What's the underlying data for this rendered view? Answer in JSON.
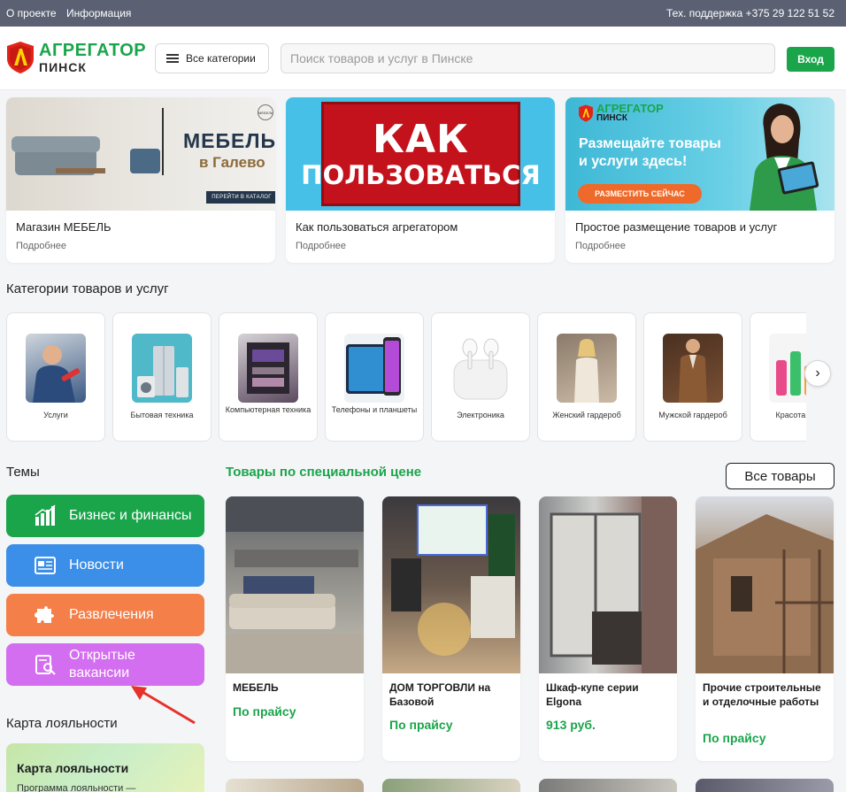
{
  "topbar": {
    "links": [
      "О проекте",
      "Информация"
    ],
    "support": "Тех. поддержка +375 29 122 51 52"
  },
  "header": {
    "logo_line1": "АГРЕГАТОР",
    "logo_line2": "ПИНСК",
    "categories_button": "Все категории",
    "search_placeholder": "Поиск товаров и услуг в Пинске",
    "login_button": "Вход"
  },
  "promos": [
    {
      "title": "Магазин МЕБЕЛЬ",
      "more": "Подробнее",
      "banner_headline": "МЕБЕЛЬ",
      "banner_sub": "в Галево",
      "banner_cta": "ПЕРЕЙТИ В КАТАЛОГ",
      "banner_logo": "МЕБЕЛЬ"
    },
    {
      "title": "Как пользоваться агрегатором",
      "more": "Подробнее",
      "banner_line1": "КАК",
      "banner_line2": "ПОЛЬЗОВАТЬСЯ"
    },
    {
      "title": "Простое размещение товаров и услуг",
      "more": "Подробнее",
      "banner_logo1": "АГРЕГАТОР",
      "banner_logo2": "ПИНСК",
      "banner_head1": "Размещайте товары",
      "banner_head2": "и услуги здесь!",
      "banner_cta": "РАЗМЕСТИТЬ СЕЙЧАС"
    }
  ],
  "categories_section": {
    "title": "Категории товаров и услуг",
    "items": [
      {
        "label": "Услуги"
      },
      {
        "label": "Бытовая техника"
      },
      {
        "label": "Компьютерная техника"
      },
      {
        "label": "Телефоны и планшеты"
      },
      {
        "label": "Электроника"
      },
      {
        "label": "Женский гардероб"
      },
      {
        "label": "Мужской гардероб"
      },
      {
        "label": "Красота и зд"
      }
    ],
    "next_arrow": "›"
  },
  "themes": {
    "title": "Темы",
    "items": [
      {
        "label": "Бизнес и финансы",
        "color": "#1aa54b",
        "icon": "chart-icon"
      },
      {
        "label": "Новости",
        "color": "#3b8fe8",
        "icon": "newspaper-icon"
      },
      {
        "label": "Развлечения",
        "color": "#f47f49",
        "icon": "puzzle-icon"
      },
      {
        "label": "Открытые вакансии",
        "color": "#d46ef0",
        "icon": "job-search-icon"
      }
    ]
  },
  "loyalty": {
    "section_title": "Карта лояльности",
    "card_title": "Карта лояльности",
    "card_sub": "Программа лояльности —"
  },
  "special": {
    "title": "Товары по специальной цене",
    "all_button": "Все товары",
    "products": [
      {
        "name": "МЕБЕЛЬ",
        "price": "По прайсу"
      },
      {
        "name": "ДОМ ТОРГОВЛИ на Базовой",
        "price": "По прайсу"
      },
      {
        "name": "Шкаф-купе серии Elgona",
        "price": "913 руб."
      },
      {
        "name": "Прочие строительные и отделочные работы",
        "price": "По прайсу"
      }
    ]
  },
  "colors": {
    "brand_green": "#1aa54b",
    "topbar": "#5b6173",
    "accent_orange": "#ef6a2a"
  }
}
